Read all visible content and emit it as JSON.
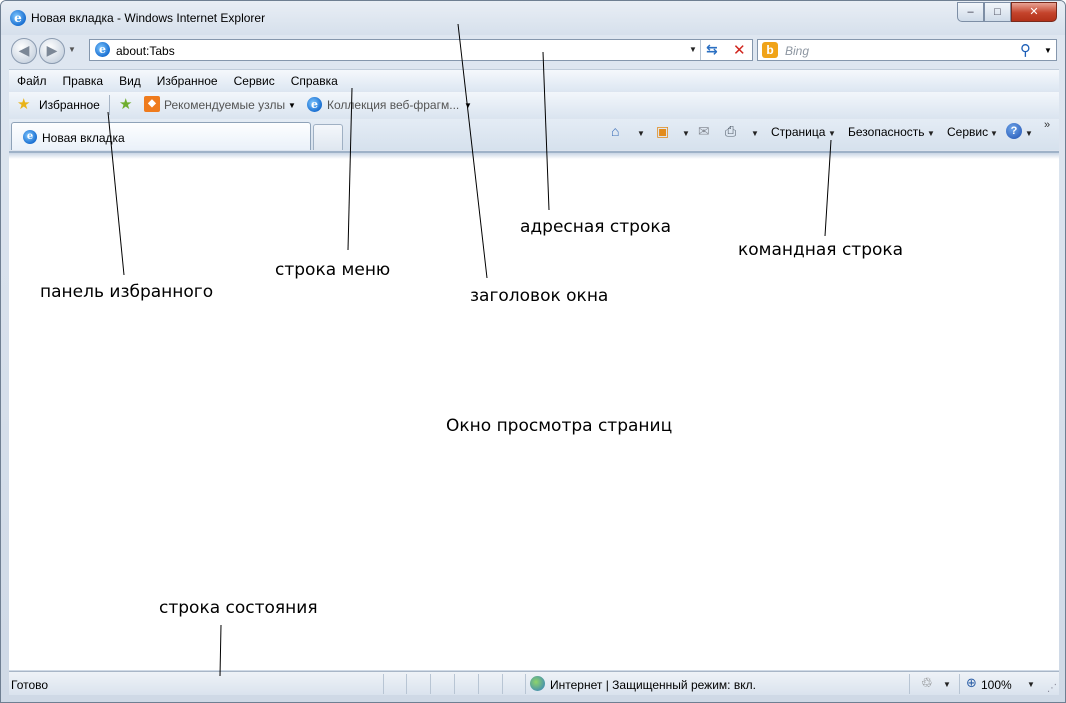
{
  "window": {
    "title": "Новая вкладка - Windows Internet Explorer",
    "caption_buttons": {
      "minimize": "–",
      "maximize": "□",
      "close": "✕"
    }
  },
  "navbar": {
    "address": "about:Tabs",
    "search_placeholder": "Bing",
    "bing_letter": "b"
  },
  "menubar": {
    "items": [
      "Файл",
      "Правка",
      "Вид",
      "Избранное",
      "Сервис",
      "Справка"
    ]
  },
  "favorites_bar": {
    "favorites_label": "Избранное",
    "recommended_label": "Рекомендуемые узлы",
    "gallery_label": "Коллекция веб-фрагм..."
  },
  "tabs": {
    "active_tab": "Новая вкладка"
  },
  "command_bar": {
    "page": "Страница",
    "safety": "Безопасность",
    "tools": "Сервис",
    "help_glyph": "?"
  },
  "status_bar": {
    "status": "Готово",
    "zone": "Интернет | Защищенный режим: вкл.",
    "zoom": "100%"
  },
  "annotations": {
    "address_bar": "адресная строка",
    "command_bar": "командная строка",
    "menu_bar": "строка меню",
    "favorites_bar": "панель избранного",
    "window_title": "заголовок окна",
    "page_view": "Окно просмотра страниц",
    "status_bar": "строка состояния"
  },
  "colors": {
    "close_button": "#c4432b",
    "link_blue": "#1d5fb7",
    "stop_red": "#d1261e"
  }
}
